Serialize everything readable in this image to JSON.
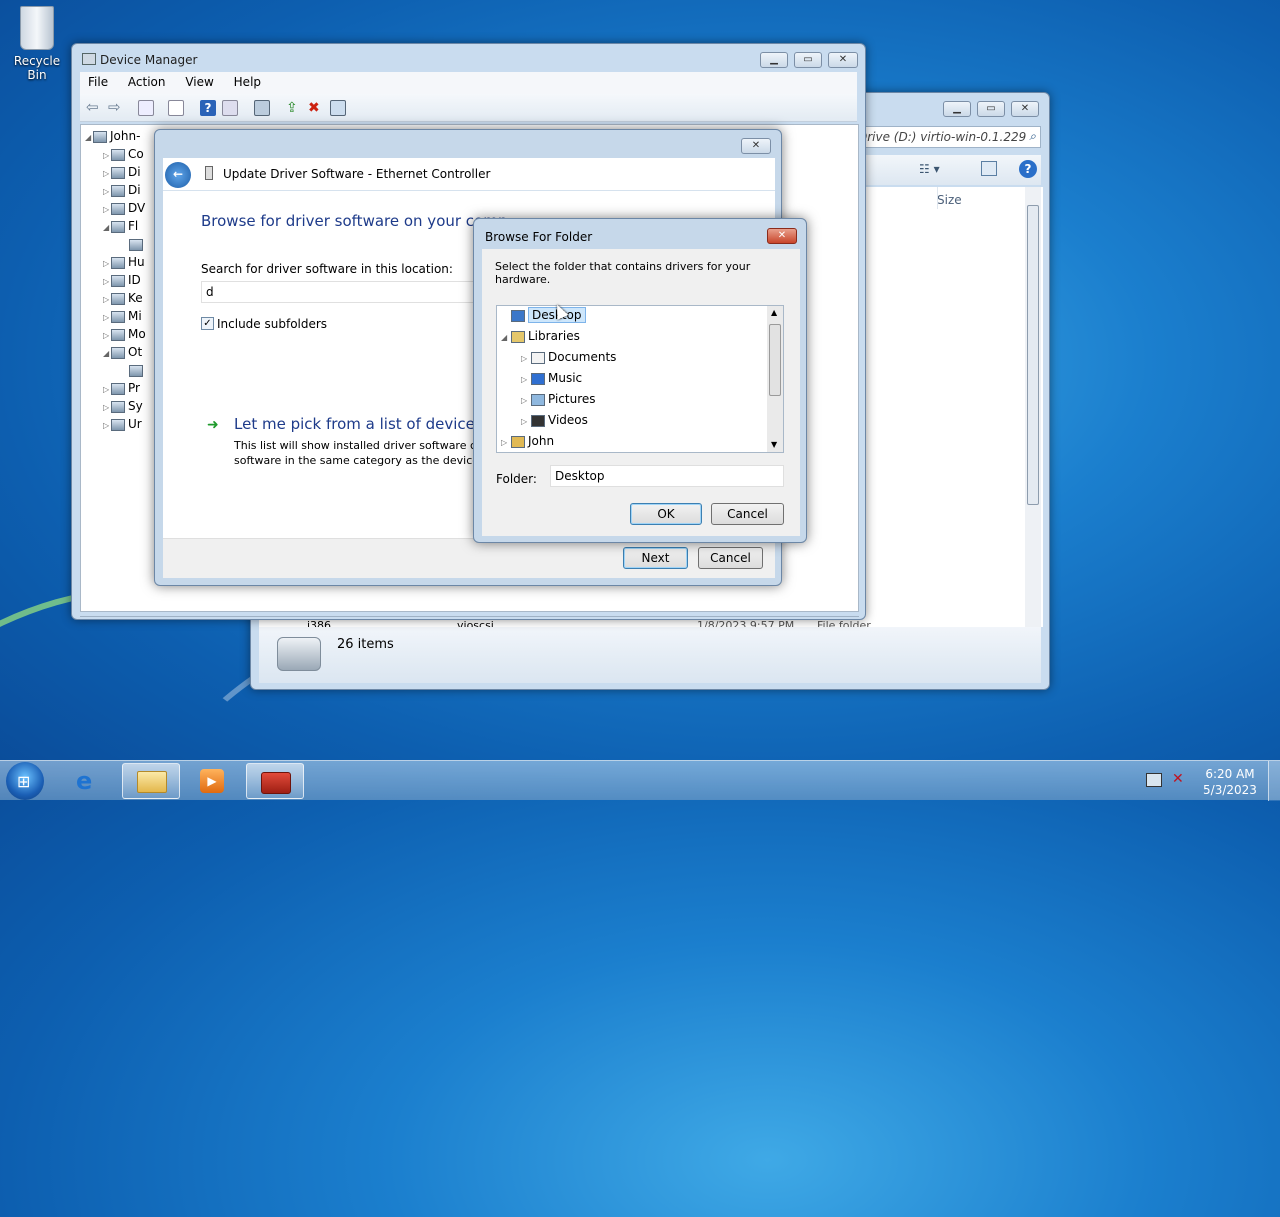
{
  "desktop": {
    "recycle_bin_label": "Recycle Bin"
  },
  "device_manager": {
    "title": "Device Manager",
    "menu": [
      "File",
      "Action",
      "View",
      "Help"
    ],
    "tree": [
      {
        "label": "John-",
        "level": 0
      },
      {
        "label": "Co",
        "level": 1
      },
      {
        "label": "Di",
        "level": 1
      },
      {
        "label": "Di",
        "level": 1
      },
      {
        "label": "DV",
        "level": 1
      },
      {
        "label": "Fl",
        "level": 1
      },
      {
        "label": "",
        "level": 2
      },
      {
        "label": "Hu",
        "level": 1
      },
      {
        "label": "ID",
        "level": 1
      },
      {
        "label": "Ke",
        "level": 1
      },
      {
        "label": "Mi",
        "level": 1
      },
      {
        "label": "Mo",
        "level": 1
      },
      {
        "label": "Ot",
        "level": 1
      },
      {
        "label": "",
        "level": 2
      },
      {
        "label": "Pr",
        "level": 1
      },
      {
        "label": "Sy",
        "level": 1
      },
      {
        "label": "Ur",
        "level": 1
      }
    ]
  },
  "explorer": {
    "address": "Drive (D:) virtio-win-0.1.229",
    "column_size": "Size",
    "rows": [
      {
        "name": "i386",
        "date": "",
        "type": ""
      },
      {
        "name": "vioscsi",
        "date": "1/8/2023 9:57 PM",
        "type": "File folder"
      }
    ],
    "status": "26 items"
  },
  "update_driver": {
    "title": "Update Driver Software - Ethernet Controller",
    "heading": "Browse for driver software on your comp",
    "search_label": "Search for driver software in this location:",
    "search_value": "d",
    "include_subfolders": "Include subfolders",
    "pick_title": "Let me pick from a list of device dri",
    "pick_desc_1": "This list will show installed driver software cor",
    "pick_desc_2": "software in the same category as the device.",
    "next": "Next",
    "cancel": "Cancel"
  },
  "browse_folder": {
    "title": "Browse For Folder",
    "instruction": "Select the folder that contains drivers for your hardware.",
    "tree": [
      {
        "label": "Desktop",
        "level": 0,
        "selected": true,
        "icon": "desktop-icon"
      },
      {
        "label": "Libraries",
        "level": 0,
        "expander": "◢",
        "icon": "libraries-icon"
      },
      {
        "label": "Documents",
        "level": 1,
        "expander": "▷",
        "icon": "documents-icon"
      },
      {
        "label": "Music",
        "level": 1,
        "expander": "▷",
        "icon": "music-icon"
      },
      {
        "label": "Pictures",
        "level": 1,
        "expander": "▷",
        "icon": "pictures-icon"
      },
      {
        "label": "Videos",
        "level": 1,
        "expander": "▷",
        "icon": "videos-icon"
      },
      {
        "label": "John",
        "level": 0,
        "expander": "▷",
        "icon": "user-folder-icon"
      }
    ],
    "folder_label": "Folder:",
    "folder_value": "Desktop",
    "ok": "OK",
    "cancel": "Cancel"
  },
  "taskbar": {
    "time": "6:20 AM",
    "date": "5/3/2023"
  }
}
